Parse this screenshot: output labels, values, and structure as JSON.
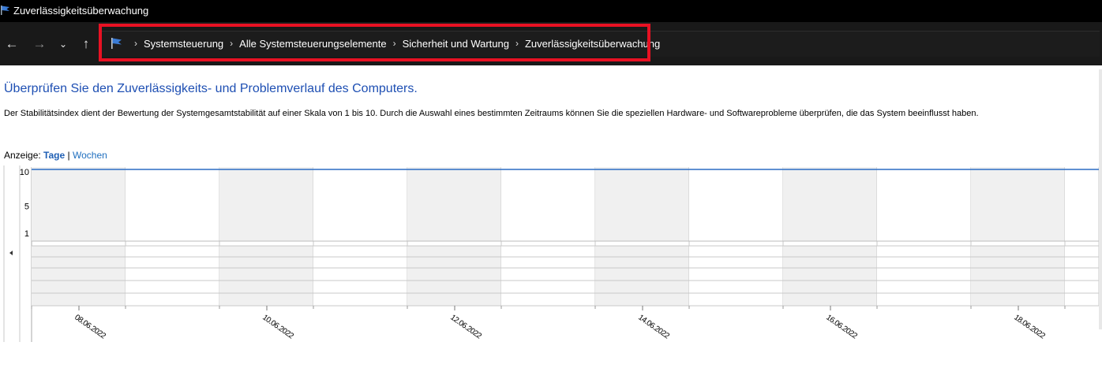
{
  "window": {
    "title": "Zuverlässigkeitsüberwachung",
    "icon": "flag-icon"
  },
  "nav": {
    "back_icon": "arrow-left-icon",
    "forward_icon": "arrow-right-icon",
    "recent_icon": "chevron-down-icon",
    "up_icon": "arrow-up-icon",
    "breadcrumbs": [
      "Systemsteuerung",
      "Alle Systemsteuerungselemente",
      "Sicherheit und Wartung",
      "Zuverlässigkeitsüberwachung"
    ]
  },
  "content": {
    "heading": "Überprüfen Sie den Zuverlässigkeits- und Problemverlauf des Computers.",
    "description": "Der Stabilitätsindex dient der Bewertung der Systemgesamtstabilität auf einer Skala von 1 bis 10. Durch die Auswahl eines bestimmten Zeitraums können Sie die speziellen Hardware- und Softwareprobleme überprüfen, die das System beeinflusst haben.",
    "view_label": "Anzeige:",
    "view_days": "Tage",
    "view_separator": "|",
    "view_weeks": "Wochen"
  },
  "colors": {
    "highlight": "#e81123",
    "heading": "#1e4fb3",
    "stability_line": "#2b6cc4"
  },
  "chart_data": {
    "type": "line",
    "ylim": [
      1,
      10
    ],
    "y_ticks": [
      "10",
      "5",
      "1"
    ],
    "date_labels": [
      "08.06.2022",
      "10.06.2022",
      "12.06.2022",
      "14.06.2022",
      "16.06.2022",
      "18.06.2022"
    ],
    "stability_index": 10
  }
}
